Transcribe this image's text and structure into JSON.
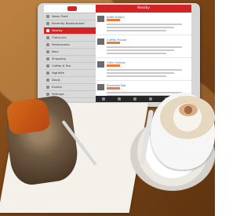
{
  "tablet_app": {
    "main_header_title": "Nearby",
    "sidebar": {
      "items": [
        {
          "label": "News Feed",
          "active": false
        },
        {
          "label": "Recently Bookmarked",
          "active": false
        },
        {
          "label": "Nearby",
          "active": true
        },
        {
          "label": "Check-ins",
          "active": false
        },
        {
          "label": "Restaurants",
          "active": false
        },
        {
          "label": "Bars",
          "active": false
        },
        {
          "label": "Shopping",
          "active": false
        },
        {
          "label": "Coffee & Tea",
          "active": false
        },
        {
          "label": "Nightlife",
          "active": false
        },
        {
          "label": "Deals",
          "active": false
        },
        {
          "label": "Events",
          "active": false
        },
        {
          "label": "Settings",
          "active": false
        }
      ]
    },
    "listings": [
      {
        "name": "Kaffe Klatch"
      },
      {
        "name": "Coffee House"
      },
      {
        "name": "Cafe Central"
      },
      {
        "name": "Espresso Bar"
      }
    ]
  },
  "colors": {
    "accent": "#d32323",
    "table_wood": "#7a4416",
    "sidebar_bg": "#d9d9d9",
    "tabbar_bg": "#262626"
  }
}
